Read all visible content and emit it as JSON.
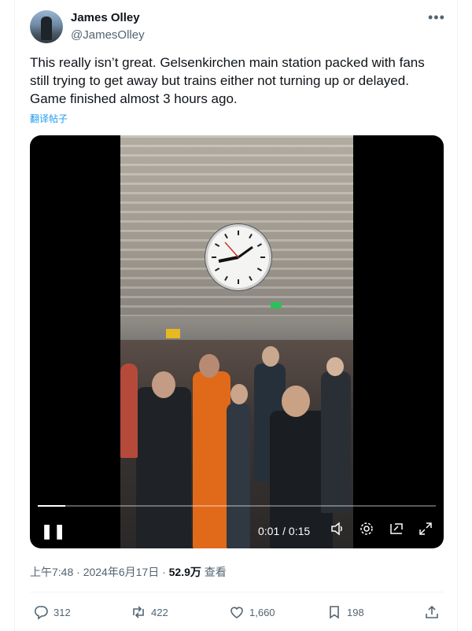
{
  "author": {
    "name": "James Olley",
    "handle": "@JamesOlley"
  },
  "tweet": {
    "text": "This really isn’t great. Gelsenkirchen main station packed with fans still trying to get away but trains either not turning up or delayed. Game finished almost 3 hours ago.",
    "translate_label": "翻译帖子"
  },
  "video": {
    "time": "0:01 / 0:15",
    "progress": 0.07
  },
  "meta": {
    "timestamp": "上午7:48 · 2024年6月17日 · ",
    "views": "52.9万",
    "views_label": " 查看"
  },
  "actions": {
    "replies": "312",
    "reposts": "422",
    "likes": "1,660",
    "bookmarks": "198"
  },
  "colors": {
    "link": "#1d9bf0",
    "secondary": "#536471",
    "primary": "#0f1419"
  }
}
